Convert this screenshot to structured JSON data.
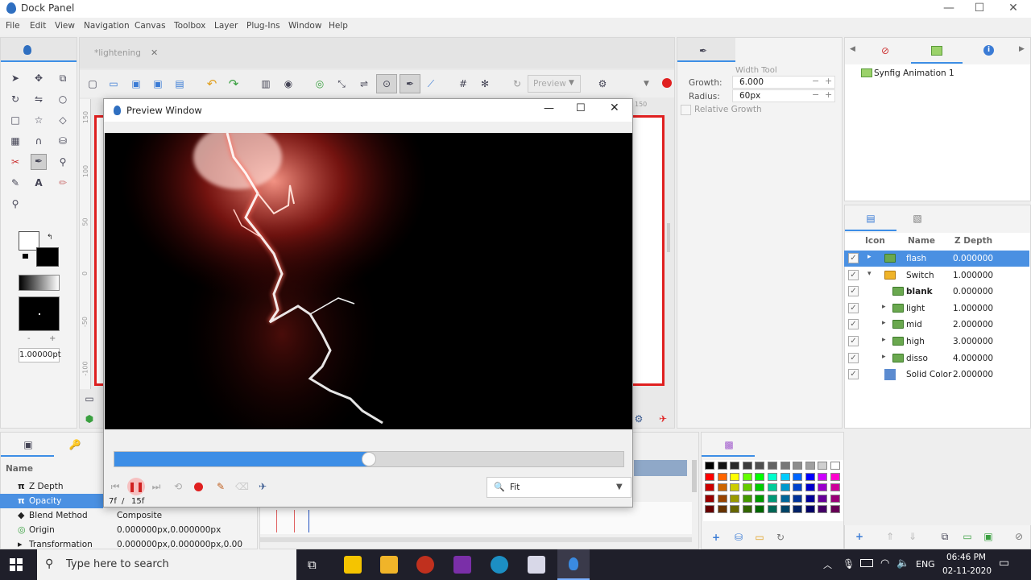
{
  "window": {
    "title": "Dock Panel",
    "minimize": "—",
    "maximize": "☐",
    "close": "✕"
  },
  "menu": [
    "File",
    "Edit",
    "View",
    "Navigation",
    "Canvas",
    "Toolbox",
    "Layer",
    "Plug-Ins",
    "Window",
    "Help"
  ],
  "canvas_tab": {
    "label": "*lightening",
    "close": "✕"
  },
  "toolbar": {
    "preview_label": "Preview"
  },
  "toolbox": {
    "brush_size": "1.00000pt",
    "minus": "-",
    "plus": "+"
  },
  "ruler": {
    "v_ticks": [
      "150",
      "100",
      "50",
      "0",
      "-50",
      "-100"
    ],
    "h_tick": "150"
  },
  "preview_window": {
    "title": "Preview Window",
    "frame_current": "7f",
    "frame_sep": "/",
    "frame_total": "15f",
    "progress": 0.5,
    "zoom_value": "Fit"
  },
  "tool_options": {
    "title": "Width Tool",
    "growth_label": "Growth:",
    "growth_value": "6.000",
    "radius_label": "Radius:",
    "radius_value": "60px",
    "relative_growth_label": "Relative Growth"
  },
  "canvas_browser": {
    "item": "Synfig Animation 1"
  },
  "layers": {
    "headers": {
      "icon": "Icon",
      "name": "Name",
      "zdepth": "Z Depth"
    },
    "rows": [
      {
        "name": "flash",
        "z": "0.000000",
        "indent": 0,
        "arrow": "▸",
        "selected": true,
        "bold": false,
        "kind": "folder"
      },
      {
        "name": "Switch",
        "z": "1.000000",
        "indent": 0,
        "arrow": "▾",
        "selected": false,
        "bold": false,
        "kind": "switch"
      },
      {
        "name": "blank",
        "z": "0.000000",
        "indent": 1,
        "arrow": "",
        "selected": false,
        "bold": true,
        "kind": "folder"
      },
      {
        "name": "light",
        "z": "1.000000",
        "indent": 1,
        "arrow": "▸",
        "selected": false,
        "bold": false,
        "kind": "folder"
      },
      {
        "name": "mid",
        "z": "2.000000",
        "indent": 1,
        "arrow": "▸",
        "selected": false,
        "bold": false,
        "kind": "folder"
      },
      {
        "name": "high",
        "z": "3.000000",
        "indent": 1,
        "arrow": "▸",
        "selected": false,
        "bold": false,
        "kind": "folder"
      },
      {
        "name": "disso",
        "z": "4.000000",
        "indent": 1,
        "arrow": "▸",
        "selected": false,
        "bold": false,
        "kind": "folder"
      },
      {
        "name": "Solid Color",
        "z": "2.000000",
        "indent": 0,
        "arrow": "",
        "selected": false,
        "bold": false,
        "kind": "solid"
      }
    ]
  },
  "params": {
    "header": "Name",
    "rows": [
      {
        "name": "Z Depth",
        "value": "",
        "icon": "π",
        "selected": false
      },
      {
        "name": "Opacity",
        "value": "",
        "icon": "π",
        "selected": true
      },
      {
        "name": "Blend Method",
        "value": "Composite",
        "icon": "◆",
        "selected": false
      },
      {
        "name": "Origin",
        "value": "0.000000px,0.000000px",
        "icon": "◎",
        "selected": false
      },
      {
        "name": "Transformation",
        "value": "0.000000px,0.000000px,0.00",
        "icon": "▸",
        "selected": false
      }
    ]
  },
  "palette_colors": [
    "#000000",
    "#141414",
    "#282828",
    "#3c3c3c",
    "#505050",
    "#646464",
    "#787878",
    "#8c8c8c",
    "#a0a0a0",
    "#d0d0d0",
    "#ffffff",
    "#ff0000",
    "#ff6600",
    "#ffff00",
    "#66ff00",
    "#00ff00",
    "#00ffcc",
    "#00ccff",
    "#0066ff",
    "#0000ff",
    "#cc00ff",
    "#ff00cc",
    "#cc0000",
    "#cc6600",
    "#cccc00",
    "#66cc00",
    "#00cc00",
    "#00cc99",
    "#0099cc",
    "#0044cc",
    "#0000cc",
    "#9900cc",
    "#cc0099",
    "#990000",
    "#994400",
    "#999900",
    "#449900",
    "#009900",
    "#009977",
    "#006699",
    "#003399",
    "#000099",
    "#660099",
    "#990077",
    "#660000",
    "#663300",
    "#666600",
    "#336600",
    "#006600",
    "#006655",
    "#004466",
    "#002266",
    "#000066",
    "#440066",
    "#660055"
  ],
  "taskbar": {
    "search_placeholder": "Type here to search",
    "lang": "ENG",
    "time": "06:46 PM",
    "date": "02-11-2020"
  },
  "colors": {
    "accent": "#3d8ee6",
    "selected_row": "#4a90e2",
    "canvas_border": "#e02020"
  }
}
